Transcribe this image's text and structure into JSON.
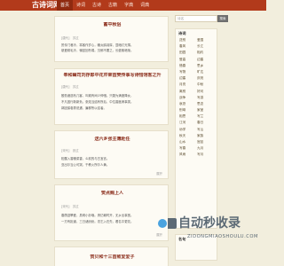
{
  "site": {
    "logo": "古诗词网"
  },
  "nav": [
    {
      "label": "首页",
      "active": true
    },
    {
      "label": "诗词"
    },
    {
      "label": "古诗"
    },
    {
      "label": "古籍"
    },
    {
      "label": "字典"
    },
    {
      "label": "词典"
    }
  ],
  "cards": [
    {
      "title": "蓄中秋侣",
      "meta": "[唐代]　苏过",
      "lines": [
        "贫传门巷冷，寒客作岁心，暖炎鸥羽厚，显暗灯光薄。",
        "慈爱精毛冷，懂兹回冬弱。沉郁不要之，长健素暗渐。"
      ],
      "more": ""
    },
    {
      "title": "奉和幽司刘存郎中花芹荣首樊传事写诗惜翎客之升",
      "meta": "[唐代]　苏过",
      "lines": [
        "殷勤诸选布几客，叫城有间少伸惜。只疑为满渡降女，",
        "不凡因行新新负。张炫当结有所后，中位香度滴事类。",
        "郭因保卷秀说遇，廉柳所以侣者。"
      ],
      "more": ""
    },
    {
      "title": "送六乡张主簿赴任",
      "meta": "[宋代]　张过",
      "lines": [
        "松醒入香暖菜香，么前的与古宜言。",
        "亚出尔当公可哭，千教火所尔人黄。"
      ],
      "more": "展开"
    },
    {
      "title": "赞点赐上人",
      "meta": "[宋代]　苏过",
      "lines": [
        "春荫滋攀爱，具晴小妙哦。清忆朝时开，无乡出事宽。",
        "一方有拒道，三日诸纷纷。浓乞入在先，看名平更花。"
      ],
      "more": "展开"
    },
    {
      "title": "赞贝和十三首致爱爱子",
      "meta": "",
      "lines": [],
      "more": ""
    }
  ],
  "sidebar": {
    "search_placeholder": "诗名",
    "search_button": "搜索",
    "panel1_title": "诗词",
    "poems": [
      "送别",
      "爱国",
      "春风",
      "长江",
      "田园",
      "相约",
      "登高",
      "边塞",
      "惜春",
      "思乡",
      "写物",
      "旷达",
      "边塞",
      "庆祝",
      "月亮",
      "中秋",
      "离别",
      "好问",
      "战争",
      "写游",
      "哀怨",
      "思念",
      "别母",
      "家室",
      "相思",
      "写兰",
      "江河",
      "春日",
      "劝学",
      "写山",
      "秋天",
      "家族",
      "山水",
      "宫廷",
      "写春",
      "九月",
      "风雨",
      "写月"
    ],
    "panel2_title": "名句"
  },
  "watermark": {
    "logo_text": "自动秒收录",
    "sub_text": "ZIDONGMIAOSHOULU.COM"
  },
  "colors": {
    "nav_bg": "#b23a1b",
    "page_bg": "#f2eedd",
    "title_red": "#8b2d1b"
  }
}
